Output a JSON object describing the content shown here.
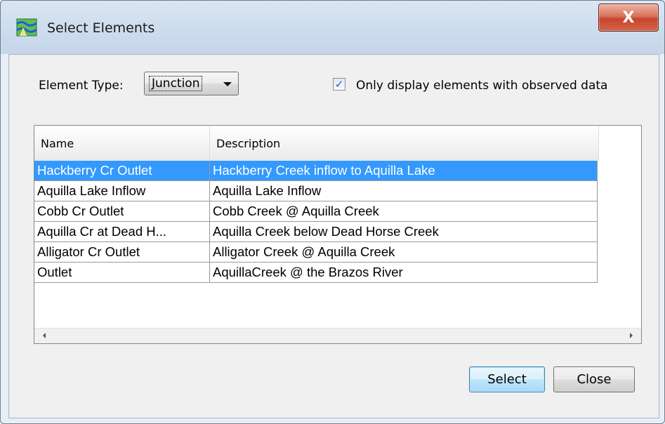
{
  "window": {
    "title": "Select Elements",
    "close_glyph": "X"
  },
  "filter": {
    "element_type_label": "Element Type:",
    "element_type_value": "Junction",
    "observed_checkbox_checked": true,
    "observed_checkbox_label": "Only display elements with observed data"
  },
  "table": {
    "columns": [
      "Name",
      "Description"
    ],
    "rows": [
      {
        "name": "Hackberry Cr Outlet",
        "description": "Hackberry Creek inflow to Aquilla Lake",
        "selected": true
      },
      {
        "name": "Aquilla Lake Inflow",
        "description": "Aquilla Lake Inflow",
        "selected": false
      },
      {
        "name": "Cobb Cr Outlet",
        "description": "Cobb Creek @ Aquilla Creek",
        "selected": false
      },
      {
        "name": "Aquilla Cr at Dead H...",
        "description": "Aquilla Creek below Dead Horse Creek",
        "selected": false
      },
      {
        "name": "Alligator Cr Outlet",
        "description": "Alligator Creek @ Aquilla Creek",
        "selected": false
      },
      {
        "name": "Outlet",
        "description": "AquillaCreek @ the Brazos River",
        "selected": false
      }
    ]
  },
  "buttons": {
    "select_label": "Select",
    "close_label": "Close"
  },
  "colors": {
    "selection": "#3399ff",
    "close_button": "#c7452c"
  },
  "icons": {
    "app": "map-icon",
    "checkmark": "checkmark-icon"
  }
}
